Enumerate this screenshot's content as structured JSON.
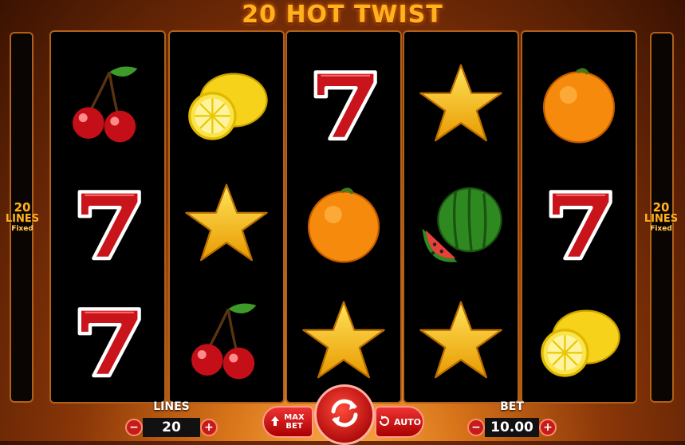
{
  "title": "20 HOT TWIST",
  "side_info": {
    "lines_count": "20",
    "lines_label": "LINES",
    "fixed_label": "Fixed"
  },
  "reels": [
    [
      "cherries",
      "seven",
      "seven"
    ],
    [
      "lemon",
      "star",
      "cherries"
    ],
    [
      "seven",
      "orange",
      "star"
    ],
    [
      "star",
      "watermelon",
      "star"
    ],
    [
      "orange",
      "seven",
      "lemon"
    ]
  ],
  "controls": {
    "lines_label": "LINES",
    "lines_value": "20",
    "bet_label": "BET",
    "bet_value": "10.00",
    "minus": "−",
    "plus": "+",
    "maxbet_label": "MAX BET",
    "auto_label": "AUTO",
    "spin_icon": "spin-arrows-icon"
  },
  "colors": {
    "accent_gold": "#ffb21e",
    "button_red": "#c51b1b",
    "reel_border": "#b06018"
  }
}
